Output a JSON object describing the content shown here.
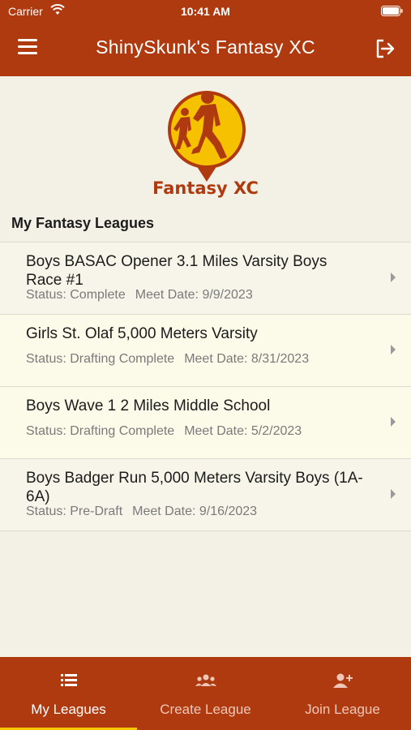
{
  "status_bar": {
    "carrier": "Carrier",
    "time": "10:41 AM"
  },
  "header": {
    "title": "ShinySkunk's Fantasy XC"
  },
  "logo": {
    "text": "Fantasy XC",
    "colors": {
      "ring": "#b03a10",
      "fill": "#f6c200"
    }
  },
  "leagues_section": {
    "title": "My Fantasy Leagues"
  },
  "leagues": [
    {
      "title": "Boys BASAC Opener 3.1 Miles Varsity Boys Race #1",
      "status_label": "Status: Complete",
      "date_label": "Meet Date: 9/9/2023"
    },
    {
      "title": "Girls St. Olaf 5,000 Meters Varsity",
      "status_label": "Status: Drafting Complete",
      "date_label": "Meet Date: 8/31/2023"
    },
    {
      "title": "Boys Wave 1 2 Miles Middle School",
      "status_label": "Status: Drafting Complete",
      "date_label": "Meet Date: 5/2/2023"
    },
    {
      "title": "Boys Badger Run 5,000 Meters Varsity Boys (1A-6A)",
      "status_label": "Status: Pre-Draft",
      "date_label": "Meet Date: 9/16/2023"
    }
  ],
  "tabs": [
    {
      "label": "My Leagues",
      "icon": "list-icon",
      "active": true
    },
    {
      "label": "Create League",
      "icon": "group-icon",
      "active": false
    },
    {
      "label": "Join League",
      "icon": "add-user-icon",
      "active": false
    }
  ],
  "colors": {
    "primary": "#b03a10",
    "accent": "#f6c800",
    "background": "#f3f1e6"
  }
}
